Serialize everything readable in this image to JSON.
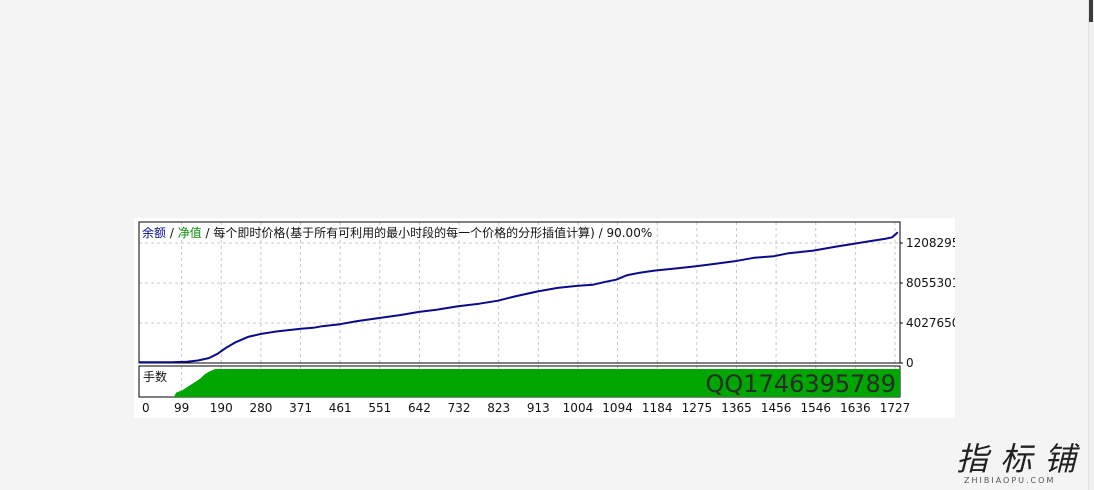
{
  "colors": {
    "balance": "#0b0b8a",
    "equity": "#0a8f0a",
    "volume_fill": "#00a600",
    "grid": "#c8c8c8",
    "frame": "#000000",
    "background": "#ffffff",
    "overlay_text": "#2b2b2b"
  },
  "chart_data": {
    "type": "line",
    "legend": {
      "balance_label": "余额",
      "separator": "/",
      "equity_label": "净值",
      "model_text": "每个即时价格(基于所有可利用的最小时段的每一个价格的分形插值计算)",
      "quality_text": "90.00%"
    },
    "x_ticks": [
      "0",
      "99",
      "190",
      "280",
      "371",
      "461",
      "551",
      "642",
      "732",
      "823",
      "913",
      "1004",
      "1094",
      "1184",
      "1275",
      "1365",
      "1456",
      "1546",
      "1636",
      "1727"
    ],
    "y_ticks": [
      "1208295",
      "8055301",
      "4027650",
      "0"
    ],
    "xlim": [
      0,
      1745
    ],
    "ylim": [
      0,
      13800000
    ],
    "series": [
      {
        "name": "余额",
        "x": [
          0,
          40,
          80,
          110,
          135,
          160,
          180,
          200,
          220,
          250,
          280,
          310,
          340,
          371,
          400,
          420,
          461,
          500,
          551,
          600,
          642,
          680,
          732,
          780,
          823,
          860,
          913,
          960,
          1004,
          1040,
          1070,
          1094,
          1120,
          1150,
          1184,
          1230,
          1275,
          1320,
          1365,
          1410,
          1456,
          1490,
          1546,
          1600,
          1636,
          1680,
          1710,
          1727,
          1740
        ],
        "y": [
          80000,
          80000,
          90000,
          130000,
          240000,
          480000,
          900000,
          1500000,
          2000000,
          2550000,
          2850000,
          3050000,
          3200000,
          3350000,
          3450000,
          3600000,
          3800000,
          4100000,
          4400000,
          4700000,
          5000000,
          5200000,
          5550000,
          5800000,
          6100000,
          6500000,
          7000000,
          7350000,
          7550000,
          7650000,
          7950000,
          8150000,
          8600000,
          8850000,
          9050000,
          9250000,
          9450000,
          9700000,
          9950000,
          10300000,
          10450000,
          10750000,
          11000000,
          11400000,
          11650000,
          11950000,
          12150000,
          12300000,
          12800000
        ]
      }
    ],
    "volume_panel": {
      "label": "手数",
      "ramp_x": [
        0,
        80,
        85,
        100,
        110,
        120,
        130,
        140,
        150,
        160,
        175,
        1745
      ],
      "ramp_level": [
        0,
        0,
        0.15,
        0.25,
        0.35,
        0.45,
        0.55,
        0.65,
        0.8,
        0.9,
        1.0,
        1.0
      ]
    },
    "overlay_text": "QQ1746395789",
    "grid": true
  },
  "watermark": {
    "glyphs": "指标铺",
    "sub": "ZHIBIAOPU.COM"
  }
}
